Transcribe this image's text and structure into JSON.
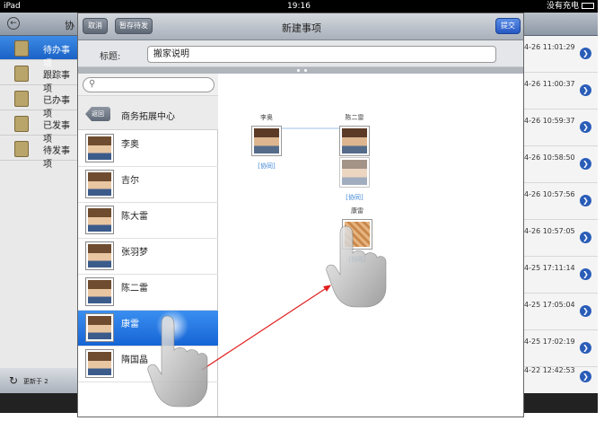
{
  "status": {
    "device": "iPad",
    "time": "19:16",
    "battery": "没有充电"
  },
  "background": {
    "nav_title": "协",
    "left_items": [
      {
        "label": "待办事项"
      },
      {
        "label": "跟踪事项"
      },
      {
        "label": "已办事项"
      },
      {
        "label": "已发事项"
      },
      {
        "label": "待发事项"
      }
    ],
    "timestamps": [
      "4-26 11:01:29",
      "4-26 11:00:37",
      "4-26 10:59:37",
      "4-26 10:58:50",
      "4-26 10:57:56",
      "4-26 10:57:05",
      "4-25 17:11:14",
      "4-25 17:05:04",
      "4-25 17:02:19",
      "4-22 12:42:53"
    ],
    "update_label": "更新于 2"
  },
  "modal": {
    "cancel": "取消",
    "save_draft": "暂存待发",
    "title": "新建事项",
    "submit": "提交",
    "subject_label": "标题:",
    "subject_value": "搬家说明",
    "back": "返回",
    "department": "商务拓展中心",
    "contacts": [
      {
        "name": "李奥"
      },
      {
        "name": "吉尔"
      },
      {
        "name": "陈大雷"
      },
      {
        "name": "张羽梦"
      },
      {
        "name": "陈二雷"
      },
      {
        "name": "康雷"
      },
      {
        "name": "隋国晶"
      }
    ]
  },
  "flow": {
    "nodes": [
      {
        "name": "李奥",
        "role": "[协同]"
      },
      {
        "name": "陈二雷",
        "role": ""
      },
      {
        "name": "",
        "role": "[协同]"
      },
      {
        "name": "康雷",
        "role": "[协同]"
      }
    ]
  },
  "colors": {
    "accent": "#1b66d2",
    "arrow": "#e01e1e",
    "role": "#3f86d6"
  },
  "icons": {
    "go": "chevron-right-icon",
    "refresh": "refresh-icon",
    "search": "search-icon",
    "back": "back-arrow-icon"
  }
}
